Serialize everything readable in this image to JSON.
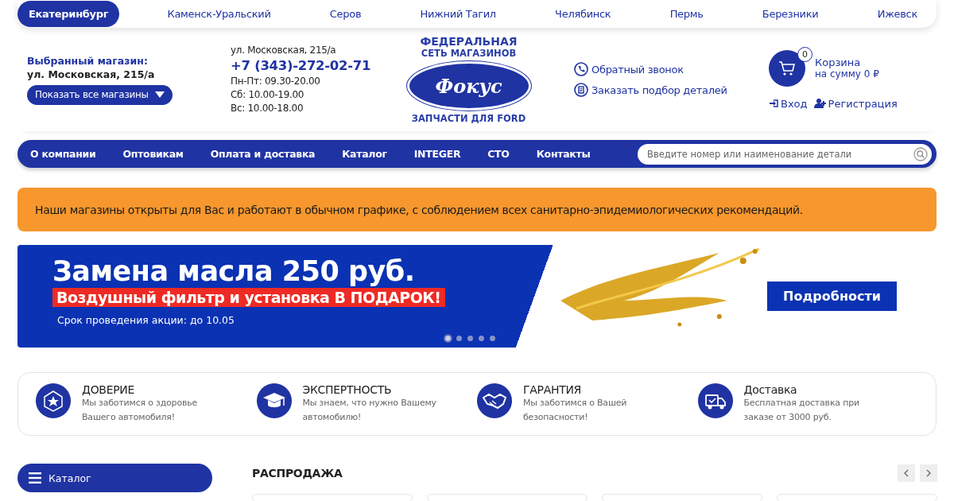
{
  "cities": [
    {
      "label": "Екатеринбург",
      "selected": true
    },
    {
      "label": "Каменск-Уральский",
      "selected": false
    },
    {
      "label": "Серов",
      "selected": false
    },
    {
      "label": "Нижний Тагил",
      "selected": false
    },
    {
      "label": "Челябинск",
      "selected": false
    },
    {
      "label": "Пермь",
      "selected": false
    },
    {
      "label": "Березники",
      "selected": false
    },
    {
      "label": "Ижевск",
      "selected": false
    }
  ],
  "store": {
    "label": "Выбранный магазин:",
    "address": "ул. Московская, 215/а",
    "button": "Показать все магазины"
  },
  "contact": {
    "address": "ул. Московская, 215/а",
    "phone": "+7 (343)-272-02-71",
    "hours": [
      "Пн-Пт: 09.30-20.00",
      "Сб: 10.00-19.00",
      "Вс: 10.00-18.00"
    ]
  },
  "logo": {
    "top": "ФЕДЕРАЛЬНАЯ",
    "middle": "СЕТЬ МАГАЗИНОВ",
    "name": "Фокус",
    "bottom": "ЗАПЧАСТИ ДЛЯ FORD"
  },
  "actions": [
    {
      "kind": "phone",
      "label": "Обратный звонок"
    },
    {
      "kind": "document",
      "label": "Заказать подбор деталей"
    }
  ],
  "cart": {
    "count": "0",
    "title": "Корзина",
    "sum": "на сумму 0 ₽"
  },
  "auth": [
    {
      "kind": "login",
      "label": "Вход"
    },
    {
      "kind": "register",
      "label": "Регистрация"
    }
  ],
  "nav": {
    "items": [
      "О компании",
      "Оптовикам",
      "Оплата и доставка",
      "Каталог",
      "INTEGER",
      "СТО",
      "Контакты"
    ],
    "search_placeholder": "Введите номер или наименование детали"
  },
  "notice": "Наши магазины открыты для Вас и работают в обычном графике, с соблюдением всех санитарно-эпидемиологических рекомендаций.",
  "promo": {
    "title": "Замена масла 250 руб.",
    "highlight": "Воздушный фильтр и установка В ПОДАРОК!",
    "note": "Срок проведения акции: до 10.05",
    "button": "Подробности",
    "dots": [
      {
        "selected": true
      },
      {
        "selected": false
      },
      {
        "selected": false
      },
      {
        "selected": false
      },
      {
        "selected": false
      }
    ]
  },
  "features": [
    {
      "kind": "badge",
      "title": "ДОВЕРИЕ",
      "text": "Мы заботимся о здоровье Вашего автомобиля!"
    },
    {
      "kind": "cap",
      "title": "ЭКСПЕРТНОСТЬ",
      "text": "Мы знаем, что нужно Вашему автомобилю!"
    },
    {
      "kind": "handshake",
      "title": "ГАРАНТИЯ",
      "text": "Мы заботимся о Вашей безопасности!"
    },
    {
      "kind": "truck",
      "title": "Доставка",
      "text": "Бесплатная доставка при заказе от 3000 руб."
    }
  ],
  "catalog_button": "Каталог",
  "sale": {
    "title": "РАСПРОДАЖА"
  }
}
